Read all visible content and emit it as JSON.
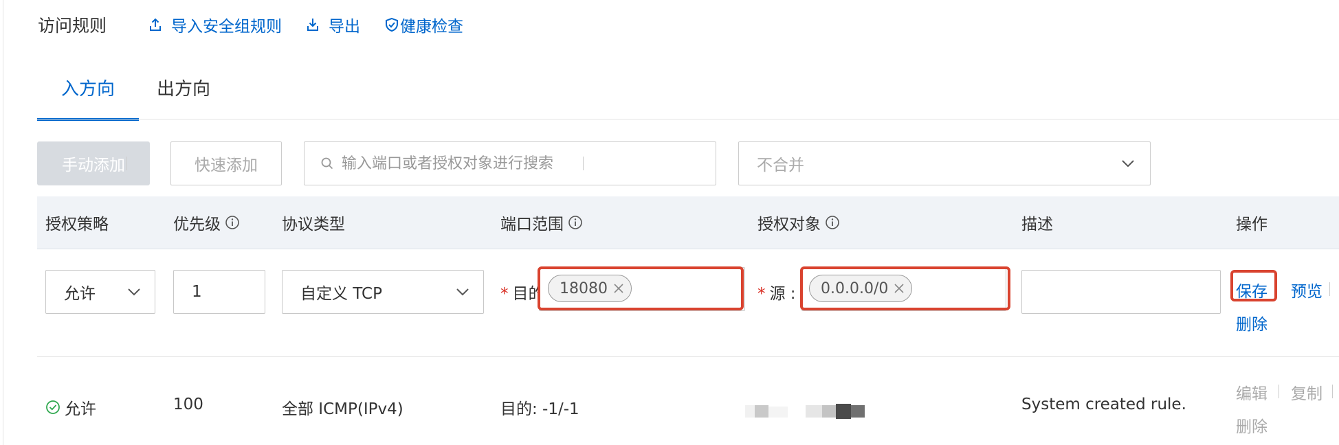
{
  "header": {
    "title": "访问规则",
    "links": {
      "import": "导入安全组规则",
      "export": "导出",
      "health": "健康检查"
    }
  },
  "tabs": {
    "inbound": "入方向",
    "outbound": "出方向",
    "active": "inbound"
  },
  "toolbar": {
    "manual_add": "手动添加",
    "quick_add": "快速添加",
    "search_placeholder": "输入端口或者授权对象进行搜索",
    "merge_select": "不合并"
  },
  "table": {
    "columns": {
      "policy": "授权策略",
      "priority": "优先级",
      "protocol": "协议类型",
      "port_range": "端口范围",
      "auth_object": "授权对象",
      "description": "描述",
      "actions": "操作"
    },
    "edit_row": {
      "policy": "允许",
      "priority": "1",
      "protocol": "自定义 TCP",
      "dest_label": "目的",
      "dest_tag": "18080",
      "source_label": "源 :",
      "source_tag": "0.0.0.0/0",
      "description": "",
      "actions": {
        "save": "保存",
        "preview": "预览",
        "delete": "删除"
      }
    },
    "rows": [
      {
        "policy": "允许",
        "priority": "100",
        "protocol": "全部 ICMP(IPv4)",
        "port_range": "目的: -1/-1",
        "description": "System created rule.",
        "actions": {
          "edit": "编辑",
          "copy": "复制",
          "delete": "删除"
        }
      }
    ]
  },
  "colors": {
    "accent": "#0066cc",
    "highlight": "#d9432f",
    "required": "#d93026",
    "allow_green": "#2fa84f"
  }
}
